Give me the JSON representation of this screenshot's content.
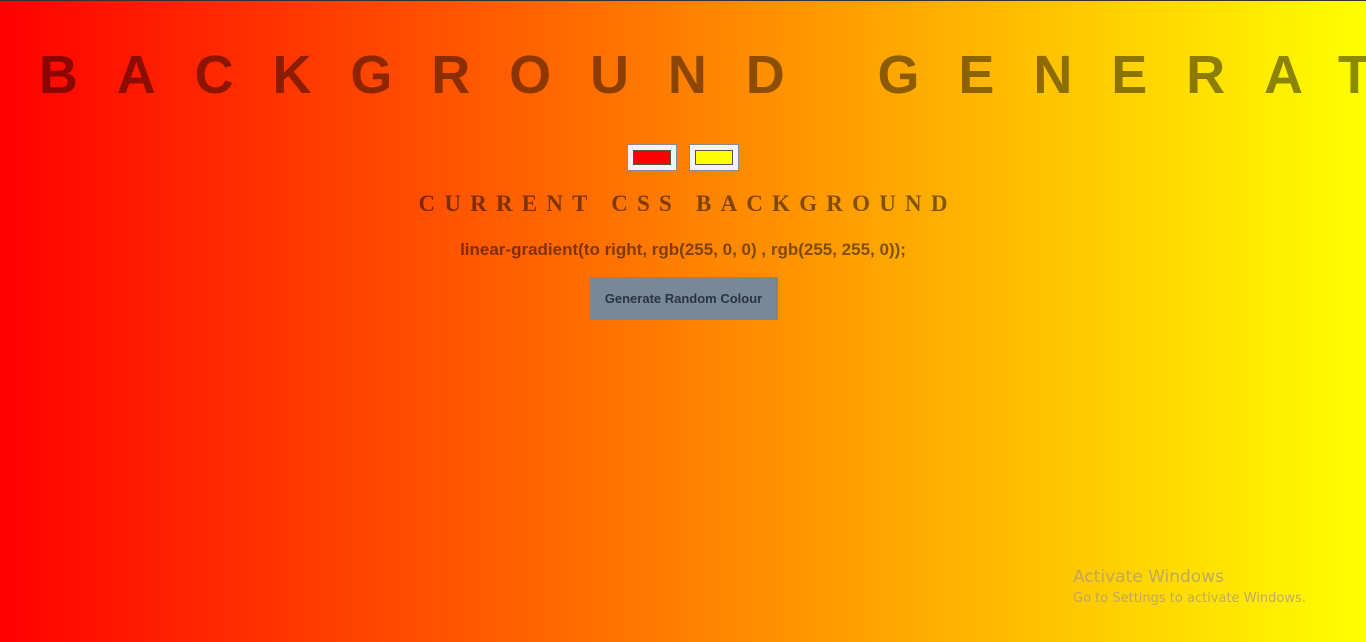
{
  "header": {
    "title": "BACKGROUND GENERATOR"
  },
  "pickers": {
    "color1": "#ff0000",
    "color2": "#ffff00"
  },
  "subtitle": "CURRENT CSS BACKGROUND",
  "css_output": "linear-gradient(to right, rgb(255, 0, 0) , rgb(255, 255, 0));",
  "button": {
    "label": "Generate Random Colour"
  },
  "watermark": {
    "title": "Activate Windows",
    "subtitle": "Go to Settings to activate Windows."
  }
}
